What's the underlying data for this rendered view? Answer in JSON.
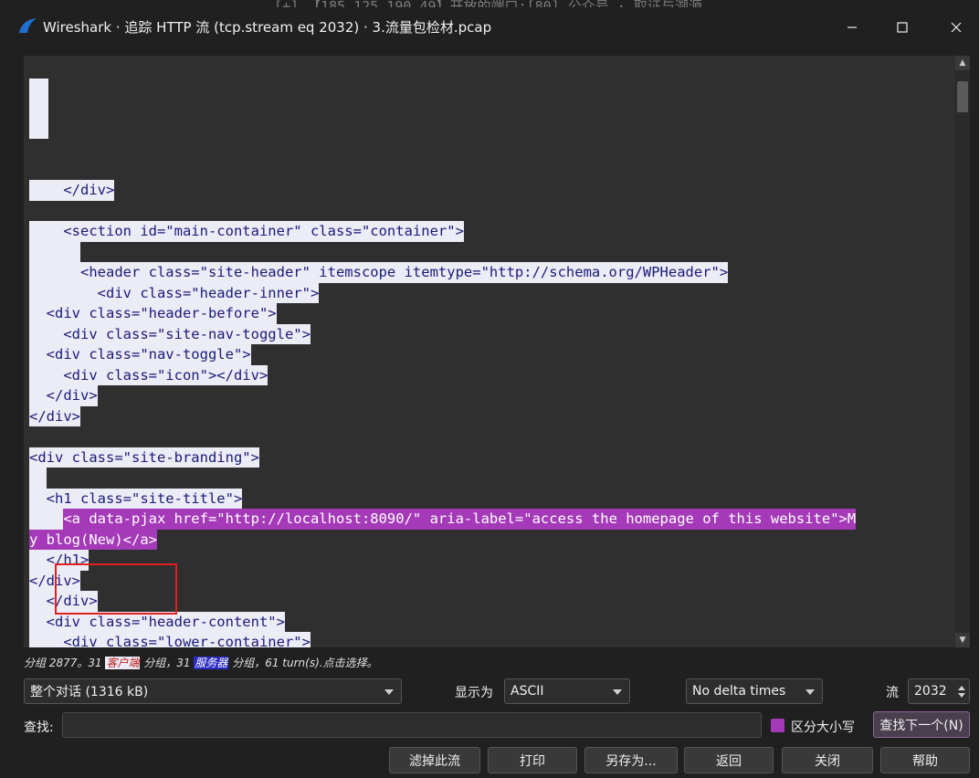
{
  "background_text": "[+] 【185.125.190.49】开放的端口:[80]        公众号 · 取证与溯源",
  "window": {
    "title": "Wireshark · 追踪 HTTP 流 (tcp.stream eq 2032) · 3.流量包检材.pcap",
    "minimize_icon": "minimize-icon",
    "maximize_icon": "maximize-icon",
    "close_icon": "close-icon"
  },
  "stream_lines": [
    {
      "side": "server",
      "text": "    </div>"
    },
    {
      "side": "none",
      "text": ""
    },
    {
      "side": "server",
      "text": "    <section id=\"main-container\" class=\"container\">"
    },
    {
      "side": "server",
      "text": "      "
    },
    {
      "side": "server",
      "text": "      <header class=\"site-header\" itemscope itemtype=\"http://schema.org/WPHeader\">"
    },
    {
      "side": "server",
      "text": "        <div class=\"header-inner\">"
    },
    {
      "side": "server",
      "text": "  <div class=\"header-before\">"
    },
    {
      "side": "server",
      "text": "    <div class=\"site-nav-toggle\">"
    },
    {
      "side": "server",
      "text": "  <div class=\"nav-toggle\">"
    },
    {
      "side": "server",
      "text": "    <div class=\"icon\"></div>"
    },
    {
      "side": "server",
      "text": "  </div>"
    },
    {
      "side": "server",
      "text": "</div>"
    },
    {
      "side": "none",
      "text": ""
    },
    {
      "side": "server",
      "text": "<div class=\"site-branding\">"
    },
    {
      "side": "server",
      "text": "  "
    },
    {
      "side": "server",
      "text": "  <h1 class=\"site-title\">"
    },
    {
      "side": "client_line",
      "lead": "    ",
      "text": "<a data-pjax href=\"http://localhost:8090/\" aria-label=\"access the homepage of this website\">M"
    },
    {
      "side": "client_wrap",
      "text": "y blog(New)</a>"
    },
    {
      "side": "server",
      "text": "  </h1>"
    },
    {
      "side": "server",
      "text": "</div>"
    },
    {
      "side": "server",
      "text": "  </div>"
    },
    {
      "side": "server",
      "text": "  <div class=\"header-content\">"
    },
    {
      "side": "server",
      "text": "    <div class=\"lower-container\">"
    }
  ],
  "status": {
    "prefix": "分组 2877。31 ",
    "client_tag": "客户端",
    "middle": " 分组，31 ",
    "server_tag": "服务器",
    "suffix": " 分组，61 turn(s).点击选择。"
  },
  "controls": {
    "conversation_select": "整个对话 (1316 kB)",
    "show_as_label": "显示为",
    "show_as_select": "ASCII",
    "delta_select": "No delta times",
    "stream_label": "流",
    "stream_value": "2032"
  },
  "find": {
    "label": "查找:",
    "value": "",
    "case_label": "区分大小写",
    "case_checked": true,
    "find_next_label": "查找下一个(N)"
  },
  "buttons": {
    "filter_out": "滤掉此流",
    "print": "打印",
    "save_as": "另存为...",
    "back": "返回",
    "close": "关闭",
    "help": "帮助"
  },
  "colors": {
    "client_bg": "#a43ab8",
    "server_bg": "#ececf7",
    "server_fg": "#1a1a7a",
    "annotation": "#e02020"
  }
}
